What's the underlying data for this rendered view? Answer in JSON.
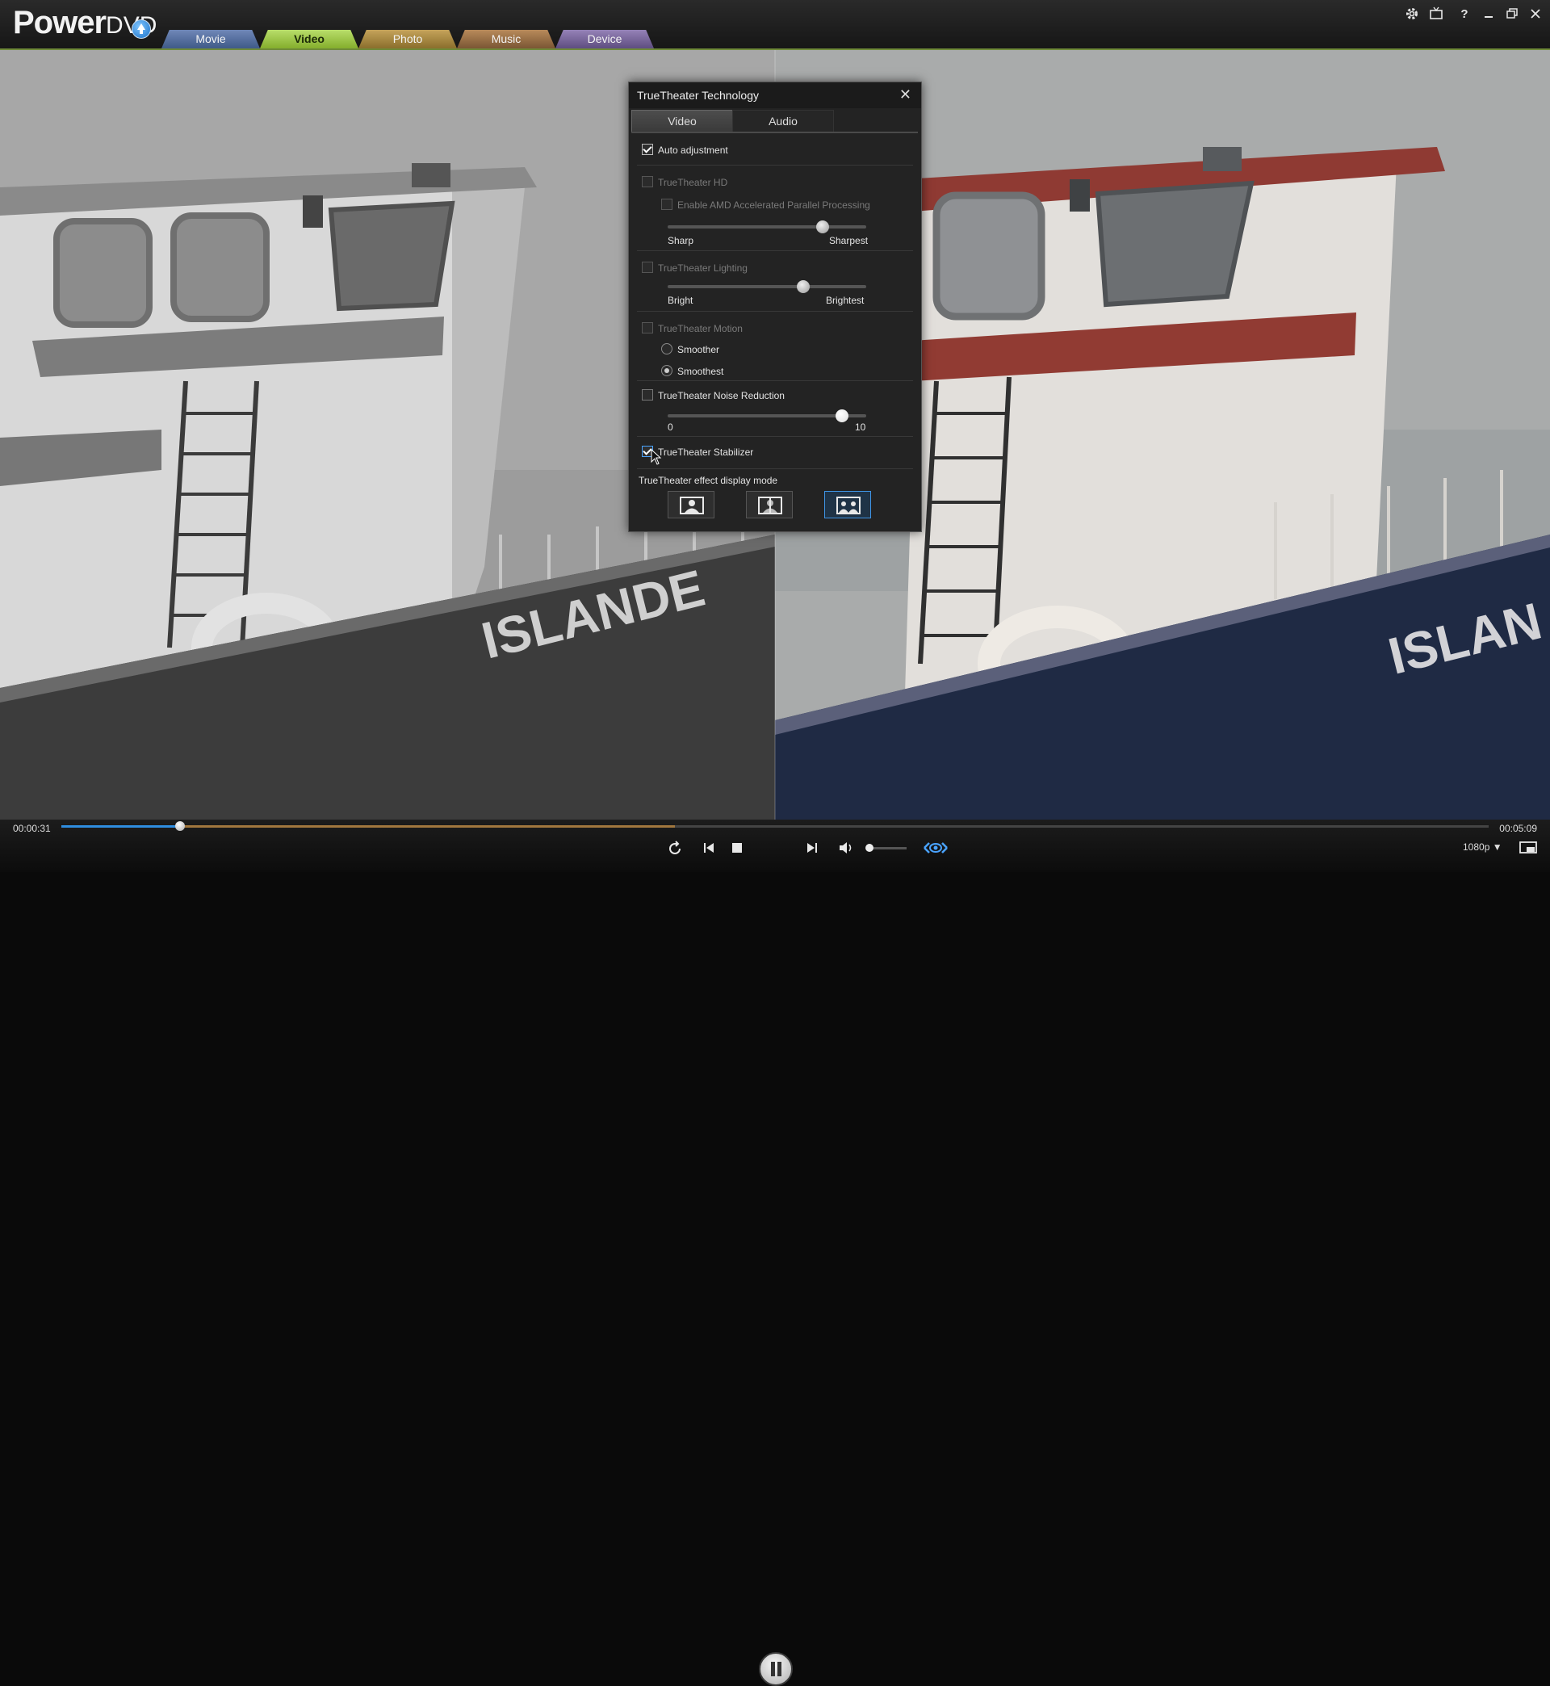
{
  "app": {
    "logo_main": "Power",
    "logo_dvd": "DVD",
    "nav_tabs": [
      {
        "label": "Movie",
        "color": "#4f6a98"
      },
      {
        "label": "Video",
        "color": "#9bc43e"
      },
      {
        "label": "Photo",
        "color": "#a8883f"
      },
      {
        "label": "Music",
        "color": "#986c44"
      },
      {
        "label": "Device",
        "color": "#766497"
      }
    ],
    "active_tab": "Video",
    "window_icons": [
      "gear-icon",
      "tv-icon",
      "help-icon",
      "minimize-icon",
      "restore-icon",
      "close-icon"
    ],
    "help_glyph": "?"
  },
  "video": {
    "hull_text": "ISLANDE",
    "hull_text_right": "ISLAN"
  },
  "dialog": {
    "title": "TrueTheater Technology",
    "close_glyph": "✕",
    "tabs": [
      "Video",
      "Audio"
    ],
    "active_tab": "Video",
    "auto_adjustment": {
      "label": "Auto adjustment",
      "checked": true
    },
    "hd": {
      "label": "TrueTheater HD",
      "checked": false,
      "amd_label": "Enable AMD Accelerated Parallel Processing",
      "slider_min_label": "Sharp",
      "slider_max_label": "Sharpest",
      "slider_value": 0.78
    },
    "lighting": {
      "label": "TrueTheater Lighting",
      "checked": false,
      "slider_min_label": "Bright",
      "slider_max_label": "Brightest",
      "slider_value": 0.68
    },
    "motion": {
      "label": "TrueTheater Motion",
      "checked": false,
      "options": [
        "Smoother",
        "Smoothest"
      ],
      "selected": "Smoothest"
    },
    "noise_reduction": {
      "label": "TrueTheater Noise Reduction",
      "checked": false,
      "slider_min_label": "0",
      "slider_max_label": "10",
      "slider_value": 0.88
    },
    "stabilizer": {
      "label": "TrueTheater Stabilizer",
      "checked": true
    },
    "display_mode": {
      "label": "TrueTheater effect display mode",
      "selected_index": 2
    }
  },
  "player": {
    "time_current": "00:00:31",
    "time_total": "00:05:09",
    "progress": 0.083,
    "buffer": 0.43,
    "volume": 0.05,
    "resolution": "1080p",
    "dropdown_glyph": "▼"
  }
}
